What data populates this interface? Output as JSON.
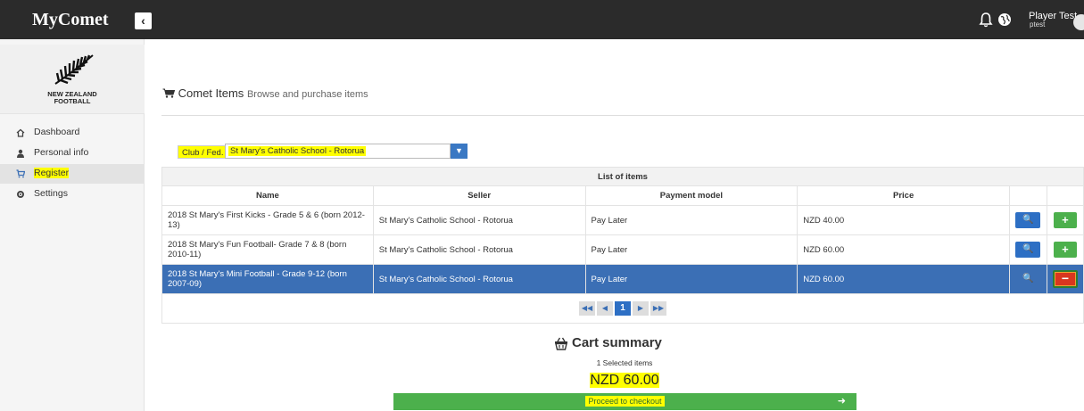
{
  "app": {
    "title": "MyComet",
    "collapse_icon": "chevron-left-icon"
  },
  "user": {
    "name": "Player Test",
    "handle": "ptest"
  },
  "logo": {
    "line1": "NEW ZEALAND",
    "line2": "FOOTBALL"
  },
  "sidebar": {
    "items": [
      {
        "label": "Dashboard",
        "icon": "home-icon"
      },
      {
        "label": "Personal info",
        "icon": "user-icon"
      },
      {
        "label": "Register",
        "icon": "cart-icon"
      },
      {
        "label": "Settings",
        "icon": "gear-icon"
      }
    ],
    "active_index": 2
  },
  "page": {
    "title": "Comet Items",
    "subtitle": "Browse and purchase items"
  },
  "filter": {
    "label": "Club / Fed.",
    "selected": "St Mary's Catholic School - Rotorua"
  },
  "table": {
    "caption": "List of items",
    "columns": [
      "Name",
      "Seller",
      "Payment model",
      "Price",
      "",
      ""
    ],
    "rows": [
      {
        "name": "2018 St Mary's First Kicks - Grade 5 & 6 (born 2012-13)",
        "seller": "St Mary's Catholic School - Rotorua",
        "payment": "Pay Later",
        "price": "NZD 40.00",
        "selected": false
      },
      {
        "name": "2018 St Mary's Fun Football- Grade 7 & 8 (born 2010-11)",
        "seller": "St Mary's Catholic School - Rotorua",
        "payment": "Pay Later",
        "price": "NZD 60.00",
        "selected": false
      },
      {
        "name": "2018 St Mary's Mini Football - Grade 9-12 (born 2007-09)",
        "seller": "St Mary's Catholic School - Rotorua",
        "payment": "Pay Later",
        "price": "NZD 60.00",
        "selected": true
      }
    ],
    "pager": {
      "current_page": "1"
    }
  },
  "cart": {
    "title": "Cart summary",
    "count_text": "1 Selected items",
    "total": "NZD 60.00",
    "checkout_label": "Proceed to checkout"
  },
  "colors": {
    "topbar": "#2b2b2b",
    "primary": "#2d6fc4",
    "success": "#4cb04c",
    "danger": "#d9361f",
    "selected_row": "#3b6fb5",
    "highlight": "#ffff00"
  }
}
